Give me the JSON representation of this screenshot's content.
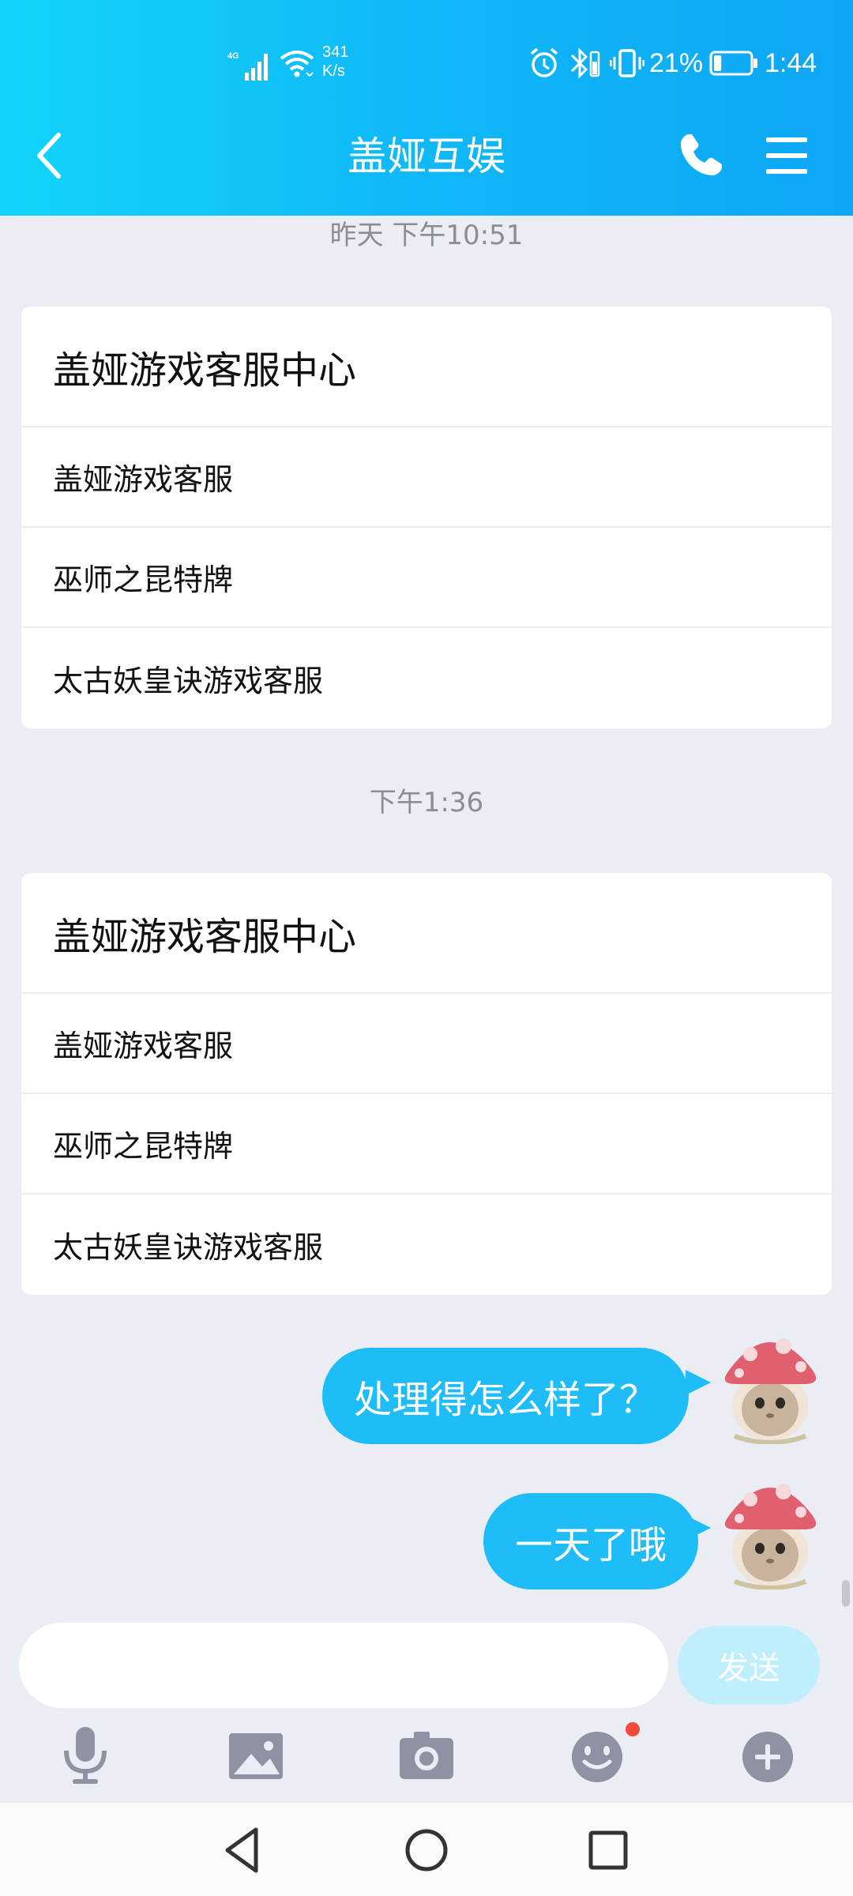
{
  "status_bar": {
    "network": "4G",
    "speed_value": "341",
    "speed_unit": "K/s",
    "battery_percent": "21%",
    "battery_level": 0.21,
    "time": "1:44"
  },
  "header": {
    "title": "盖娅互娱",
    "icons": [
      "back-arrow-icon",
      "phone-icon",
      "menu-icon"
    ]
  },
  "messages": {
    "timestamp_1": "昨天 下午10:51",
    "card_1": {
      "title": "盖娅游戏客服中心",
      "items": [
        "盖娅游戏客服",
        "巫师之昆特牌",
        "太古妖皇诀游戏客服"
      ]
    },
    "timestamp_2": "下午1:36",
    "card_2": {
      "title": "盖娅游戏客服中心",
      "items": [
        "盖娅游戏客服",
        "巫师之昆特牌",
        "太古妖皇诀游戏客服"
      ]
    },
    "outgoing": [
      "处理得怎么样了？",
      "一天了哦"
    ]
  },
  "input": {
    "placeholder": "",
    "send_label": "发送"
  },
  "toolbar": {
    "icons": [
      "microphone-icon",
      "image-icon",
      "camera-icon",
      "emoji-icon",
      "plus-icon"
    ],
    "emoji_has_badge": true
  },
  "colors": {
    "header_gradient_start": "#12d4fb",
    "header_gradient_end": "#0ea6f4",
    "bubble": "#1ebdf8",
    "send_button": "#bfeefd",
    "background": "#ebedf5",
    "badge": "#f44a3c"
  }
}
